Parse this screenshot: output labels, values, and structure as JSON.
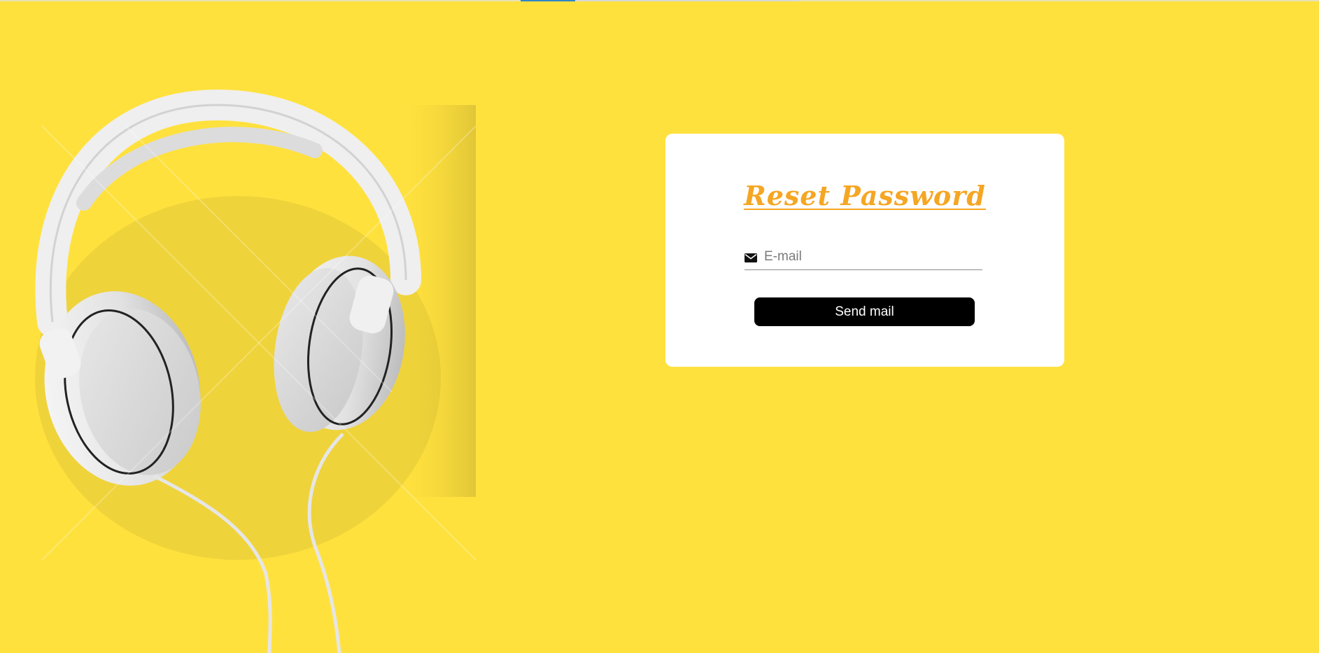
{
  "colors": {
    "background": "#FFE13E",
    "card": "#FFFFFF",
    "title": "#F5A623",
    "button": "#000000",
    "button_text": "#FFFFFF"
  },
  "hero": {
    "icon": "headphones-illustration"
  },
  "reset_card": {
    "title": "Reset Password",
    "email_field": {
      "icon": "envelope-icon",
      "placeholder": "E-mail",
      "value": ""
    },
    "send_button_label": "Send mail"
  }
}
